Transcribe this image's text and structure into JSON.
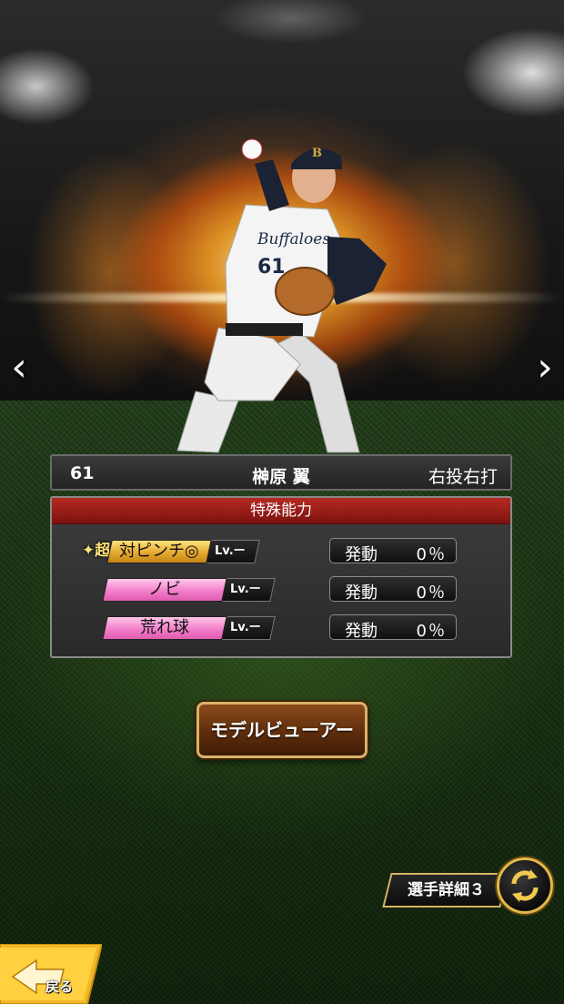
{
  "player": {
    "number": "61",
    "name": "榊原 翼",
    "throw_bat": "右投右打",
    "jersey_number": "61",
    "jersey_text": "Buffaloes"
  },
  "abilities_panel": {
    "title": "特殊能力",
    "rows": [
      {
        "prefix": "超",
        "name": "対ピンチ◎",
        "level": "Lv.ー",
        "activation_label": "発動",
        "activation_pct": "0％",
        "style": "gold"
      },
      {
        "prefix": "",
        "name": "ノビ",
        "level": "Lv.ー",
        "activation_label": "発動",
        "activation_pct": "0％",
        "style": "pink"
      },
      {
        "prefix": "",
        "name": "荒れ球",
        "level": "Lv.ー",
        "activation_label": "発動",
        "activation_pct": "0％",
        "style": "pink"
      }
    ]
  },
  "buttons": {
    "model_viewer": "モデルビューアー",
    "player_detail": "選手詳細３",
    "back": "戻る",
    "prev": "‹",
    "next": "›"
  },
  "colors": {
    "gold_badge": "#e2a52a",
    "pink_badge": "#f17ac8",
    "header_red": "#9c1d18",
    "accent_gold": "#d6b463"
  },
  "icons": {
    "prev": "chevron-left-icon",
    "next": "chevron-right-icon",
    "switch": "refresh-arrows-icon",
    "back": "back-arrow-icon"
  }
}
